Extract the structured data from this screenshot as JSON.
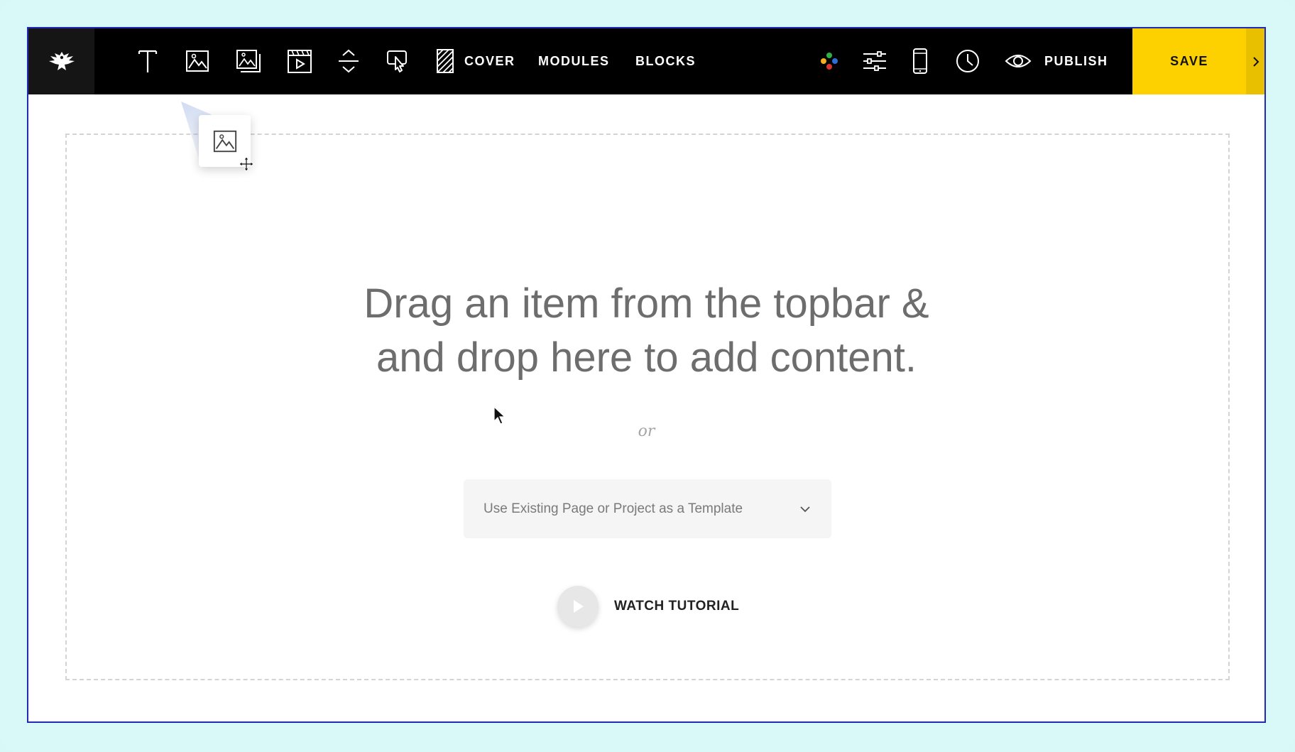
{
  "topbar": {
    "tools": [
      {
        "icon": "text-icon"
      },
      {
        "icon": "image-icon"
      },
      {
        "icon": "gallery-icon"
      },
      {
        "icon": "video-icon"
      },
      {
        "icon": "spacer-icon"
      },
      {
        "icon": "button-icon"
      },
      {
        "icon": "pattern-icon"
      }
    ],
    "nav": {
      "cover": "COVER",
      "modules": "MODULES",
      "blocks": "BLOCKS"
    },
    "right_icons": [
      "colors-icon",
      "settings-sliders-icon",
      "mobile-icon",
      "history-clock-icon",
      "preview-eye-icon"
    ],
    "publish_label": "PUBLISH",
    "save_label": "SAVE",
    "colors": {
      "save_bg": "#fdd000",
      "topbar_bg": "#000000"
    }
  },
  "canvas": {
    "headline_line1": "Drag an item from the topbar &",
    "headline_line2": "and drop here to add content.",
    "or_text": "or",
    "template_select": {
      "selected": "Use Existing Page or Project as a Template"
    },
    "tutorial_label": "WATCH TUTORIAL"
  }
}
